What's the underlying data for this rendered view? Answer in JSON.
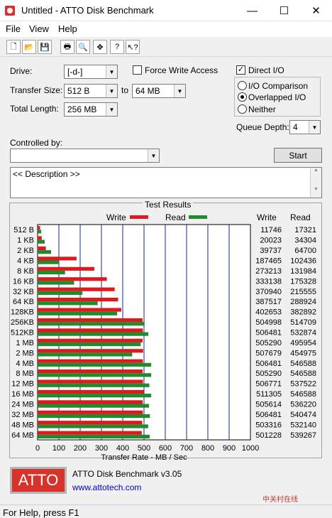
{
  "window": {
    "title": "Untitled - ATTO Disk Benchmark",
    "minimize_icon": "minimize-icon",
    "maximize_icon": "maximize-icon",
    "close_icon": "close-icon"
  },
  "menu": [
    "File",
    "View",
    "Help"
  ],
  "toolbar": {
    "icons": [
      "new-icon",
      "open-icon",
      "save-icon",
      "print-icon",
      "print-preview-icon",
      "move-icon",
      "help-icon",
      "context-help-icon"
    ]
  },
  "settings": {
    "drive_label": "Drive:",
    "drive_value": "[-d-]",
    "transfer_label": "Transfer Size:",
    "transfer_from": "512 B",
    "to_label": "to",
    "transfer_to": "64 MB",
    "length_label": "Total Length:",
    "length_value": "256 MB",
    "force_write_label": "Force Write Access",
    "force_write_checked": false,
    "direct_io_label": "Direct I/O",
    "direct_io_checked": true,
    "io_comparison_label": "I/O Comparison",
    "overlapped_label": "Overlapped I/O",
    "neither_label": "Neither",
    "selected_mode": "overlapped",
    "queue_label": "Queue Depth:",
    "queue_value": "4",
    "controlled_label": "Controlled by:",
    "controlled_value": "",
    "start_label": "Start",
    "description": "<< Description >>"
  },
  "results": {
    "group_title": "Test Results",
    "write_legend": "Write",
    "read_legend": "Read",
    "write_col": "Write",
    "read_col": "Read"
  },
  "chart_data": {
    "type": "bar",
    "orientation": "horizontal",
    "xlabel": "Transfer Rate - MB / Sec",
    "xlim": [
      0,
      1000
    ],
    "xticks": [
      0,
      100,
      200,
      300,
      400,
      500,
      600,
      700,
      800,
      900,
      1000
    ],
    "colors": {
      "write": "#e0191e",
      "read": "#1f8c2c"
    },
    "categories": [
      "512 B",
      "1 KB",
      "2 KB",
      "4 KB",
      "8 KB",
      "16 KB",
      "32 KB",
      "64 KB",
      "128KB",
      "256KB",
      "512KB",
      "1 MB",
      "2 MB",
      "4 MB",
      "8 MB",
      "12 MB",
      "16 MB",
      "24 MB",
      "32 MB",
      "48 MB",
      "64 MB"
    ],
    "series": [
      {
        "name": "Write",
        "values": [
          11746,
          20023,
          39737,
          187465,
          273213,
          333138,
          370940,
          387517,
          402653,
          504998,
          506481,
          505290,
          507679,
          506481,
          505290,
          506771,
          511305,
          505614,
          506481,
          503316,
          501228
        ]
      },
      {
        "name": "Read",
        "values": [
          17321,
          34304,
          64700,
          102436,
          131984,
          175328,
          215555,
          288924,
          382892,
          514709,
          532874,
          495954,
          454975,
          546588,
          546588,
          537522,
          546588,
          536220,
          540474,
          532140,
          539267
        ]
      }
    ]
  },
  "footer": {
    "logo": "ATTO",
    "product": "ATTO Disk Benchmark v3.05",
    "url": "www.attotech.com",
    "watermark": "中关村在线 ZOL.COM.CN"
  },
  "status": "For Help, press F1"
}
